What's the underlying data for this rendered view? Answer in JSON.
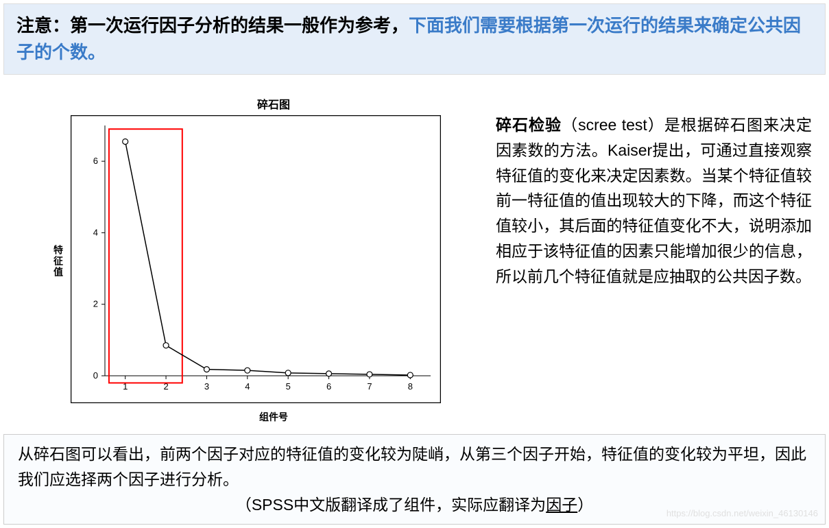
{
  "header": {
    "bold_part": "注意：第一次运行因子分析的结果一般作为参考，",
    "blue_part": "下面我们需要根据第一次运行的结果来确定公共因子的个数。"
  },
  "chart_data": {
    "type": "line",
    "title": "碎石图",
    "xlabel": "组件号",
    "ylabel": "特征值",
    "x": [
      1,
      2,
      3,
      4,
      5,
      6,
      7,
      8
    ],
    "values": [
      6.55,
      0.85,
      0.18,
      0.15,
      0.08,
      0.06,
      0.04,
      0.02
    ],
    "ylim": [
      0,
      7
    ],
    "yticks": [
      0,
      2,
      4,
      6
    ],
    "xlim": [
      0.5,
      8.5
    ],
    "highlight_box": {
      "xmin": 0.6,
      "xmax": 2.4,
      "ymin": -0.2,
      "ymax": 6.9
    }
  },
  "right_text": {
    "bold": "碎石检验",
    "paren": "（scree test）",
    "rest": "是根据碎石图来决定因素数的方法。Kaiser提出，可通过直接观察特征值的变化来决定因素数。当某个特征值较前一特征值的值出现较大的下降，而这个特征值较小，其后面的特征值变化不大，说明添加相应于该特征值的因素只能增加很少的信息，所以前几个特征值就是应抽取的公共因子数。"
  },
  "footer": {
    "line1": "从碎石图可以看出，前两个因子对应的特征值的变化较为陡峭，从第三个因子开始，特征值的变化较为平坦，因此我们应选择两个因子进行分析。",
    "line2_pre": "（SPSS中文版翻译成了组件，实际应翻译为",
    "line2_underline": "因子",
    "line2_post": "）"
  },
  "watermark": "https://blog.csdn.net/weixin_46130146"
}
